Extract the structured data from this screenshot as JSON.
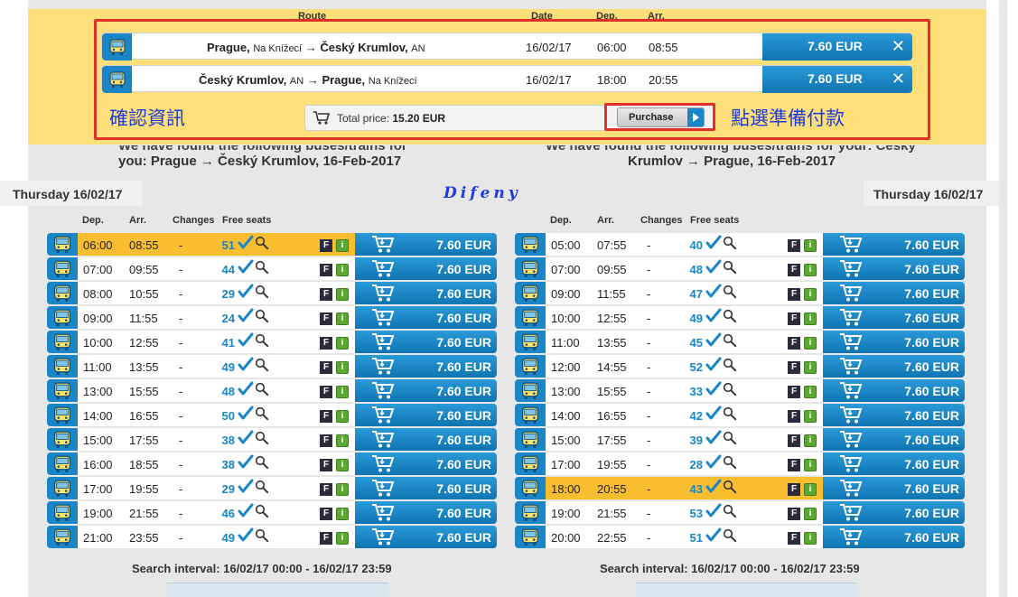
{
  "cart": {
    "headers": {
      "route": "Route",
      "date": "Date",
      "dep": "Dep.",
      "arr": "Arr."
    },
    "trips": [
      {
        "from": "Prague,",
        "from_stop": "Na Knížecí",
        "arrow": "→",
        "to": "Český Krumlov,",
        "to_stop": "AN",
        "date": "16/02/17",
        "dep": "06:00",
        "arr": "08:55",
        "price": "7.60 EUR",
        "remove": "✕"
      },
      {
        "from": "Český Krumlov,",
        "from_stop": "AN",
        "arrow": "→",
        "to": "Prague,",
        "to_stop": "Na Knížecí",
        "date": "16/02/17",
        "dep": "18:00",
        "arr": "20:55",
        "price": "7.60 EUR",
        "remove": "✕"
      }
    ],
    "confirm_note": "確認資訊",
    "pay_note": "點選準備付款",
    "total_label": "Total price:",
    "total_value": "15.20 EUR",
    "purchase_label": "Purchase"
  },
  "left": {
    "found_line1": "We have found the following buses/trains for",
    "found_line2": "you: Prague → Český Krumlov, 16-Feb-2017",
    "day": "Thursday 16/02/17",
    "interval": "Search interval: 16/02/17 00:00 - 16/02/17 23:59",
    "rows": [
      {
        "dep": "06:00",
        "arr": "08:55",
        "chg": "-",
        "seats": "51",
        "f": "F",
        "i": "i",
        "price": "7.60 EUR",
        "selected": true
      },
      {
        "dep": "07:00",
        "arr": "09:55",
        "chg": "-",
        "seats": "44",
        "f": "F",
        "i": "i",
        "price": "7.60 EUR"
      },
      {
        "dep": "08:00",
        "arr": "10:55",
        "chg": "-",
        "seats": "29",
        "f": "F",
        "i": "i",
        "price": "7.60 EUR"
      },
      {
        "dep": "09:00",
        "arr": "11:55",
        "chg": "-",
        "seats": "24",
        "f": "F",
        "i": "i",
        "price": "7.60 EUR"
      },
      {
        "dep": "10:00",
        "arr": "12:55",
        "chg": "-",
        "seats": "41",
        "f": "F",
        "i": "i",
        "price": "7.60 EUR"
      },
      {
        "dep": "11:00",
        "arr": "13:55",
        "chg": "-",
        "seats": "49",
        "f": "F",
        "i": "i",
        "price": "7.60 EUR"
      },
      {
        "dep": "13:00",
        "arr": "15:55",
        "chg": "-",
        "seats": "48",
        "f": "F",
        "i": "i",
        "price": "7.60 EUR"
      },
      {
        "dep": "14:00",
        "arr": "16:55",
        "chg": "-",
        "seats": "50",
        "f": "F",
        "i": "i",
        "price": "7.60 EUR"
      },
      {
        "dep": "15:00",
        "arr": "17:55",
        "chg": "-",
        "seats": "38",
        "f": "F",
        "i": "i",
        "price": "7.60 EUR"
      },
      {
        "dep": "16:00",
        "arr": "18:55",
        "chg": "-",
        "seats": "38",
        "f": "F",
        "i": "i",
        "price": "7.60 EUR"
      },
      {
        "dep": "17:00",
        "arr": "19:55",
        "chg": "-",
        "seats": "29",
        "f": "F",
        "i": "i",
        "price": "7.60 EUR"
      },
      {
        "dep": "19:00",
        "arr": "21:55",
        "chg": "-",
        "seats": "46",
        "f": "F",
        "i": "i",
        "price": "7.60 EUR"
      },
      {
        "dep": "21:00",
        "arr": "23:55",
        "chg": "-",
        "seats": "49",
        "f": "F",
        "i": "i",
        "price": "7.60 EUR"
      }
    ]
  },
  "right": {
    "found_line1": "We have found the following buses/trains for your: Český",
    "found_line2": "Krumlov → Prague, 16-Feb-2017",
    "day": "Thursday 16/02/17",
    "interval": "Search interval: 16/02/17 00:00 - 16/02/17 23:59",
    "rows": [
      {
        "dep": "05:00",
        "arr": "07:55",
        "chg": "-",
        "seats": "40",
        "f": "F",
        "i": "i",
        "price": "7.60 EUR"
      },
      {
        "dep": "07:00",
        "arr": "09:55",
        "chg": "-",
        "seats": "48",
        "f": "F",
        "i": "i",
        "price": "7.60 EUR"
      },
      {
        "dep": "09:00",
        "arr": "11:55",
        "chg": "-",
        "seats": "47",
        "f": "F",
        "i": "i",
        "price": "7.60 EUR"
      },
      {
        "dep": "10:00",
        "arr": "12:55",
        "chg": "-",
        "seats": "49",
        "f": "F",
        "i": "i",
        "price": "7.60 EUR"
      },
      {
        "dep": "11:00",
        "arr": "13:55",
        "chg": "-",
        "seats": "45",
        "f": "F",
        "i": "i",
        "price": "7.60 EUR"
      },
      {
        "dep": "12:00",
        "arr": "14:55",
        "chg": "-",
        "seats": "52",
        "f": "F",
        "i": "i",
        "price": "7.60 EUR"
      },
      {
        "dep": "13:00",
        "arr": "15:55",
        "chg": "-",
        "seats": "33",
        "f": "F",
        "i": "i",
        "price": "7.60 EUR"
      },
      {
        "dep": "14:00",
        "arr": "16:55",
        "chg": "-",
        "seats": "42",
        "f": "F",
        "i": "i",
        "price": "7.60 EUR"
      },
      {
        "dep": "15:00",
        "arr": "17:55",
        "chg": "-",
        "seats": "39",
        "f": "F",
        "i": "i",
        "price": "7.60 EUR"
      },
      {
        "dep": "17:00",
        "arr": "19:55",
        "chg": "-",
        "seats": "28",
        "f": "F",
        "i": "i",
        "price": "7.60 EUR"
      },
      {
        "dep": "18:00",
        "arr": "20:55",
        "chg": "-",
        "seats": "43",
        "f": "F",
        "i": "i",
        "price": "7.60 EUR",
        "selected": true
      },
      {
        "dep": "19:00",
        "arr": "21:55",
        "chg": "-",
        "seats": "53",
        "f": "F",
        "i": "i",
        "price": "7.60 EUR"
      },
      {
        "dep": "20:00",
        "arr": "22:55",
        "chg": "-",
        "seats": "51",
        "f": "F",
        "i": "i",
        "price": "7.60 EUR"
      }
    ]
  },
  "columns": {
    "dep": "Dep.",
    "arr": "Arr.",
    "changes": "Changes",
    "seats": "Free seats"
  },
  "watermark": "Difeny",
  "colors": {
    "accent_blue": "#1a86c8",
    "highlight": "#f9bd30",
    "cart_bg": "#fde07a",
    "annotation": "#e0302a"
  }
}
